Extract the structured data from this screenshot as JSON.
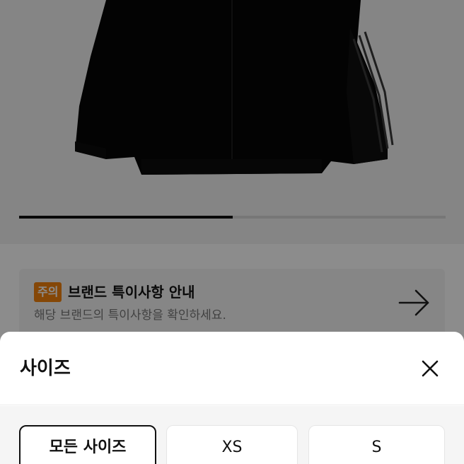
{
  "product_image": {
    "alt": "product-photo",
    "progress": 0.5
  },
  "notice": {
    "badge": "주의",
    "title": "브랜드 특이사항 안내",
    "description": "해당 브랜드의 특이사항을 확인하세요.",
    "arrow_icon": "arrow-right-icon"
  },
  "size_sheet": {
    "title": "사이즈",
    "close_icon": "close-icon",
    "options": [
      {
        "label": "모든 사이즈",
        "selected": true
      },
      {
        "label": "XS",
        "selected": false
      },
      {
        "label": "S",
        "selected": false
      }
    ]
  }
}
